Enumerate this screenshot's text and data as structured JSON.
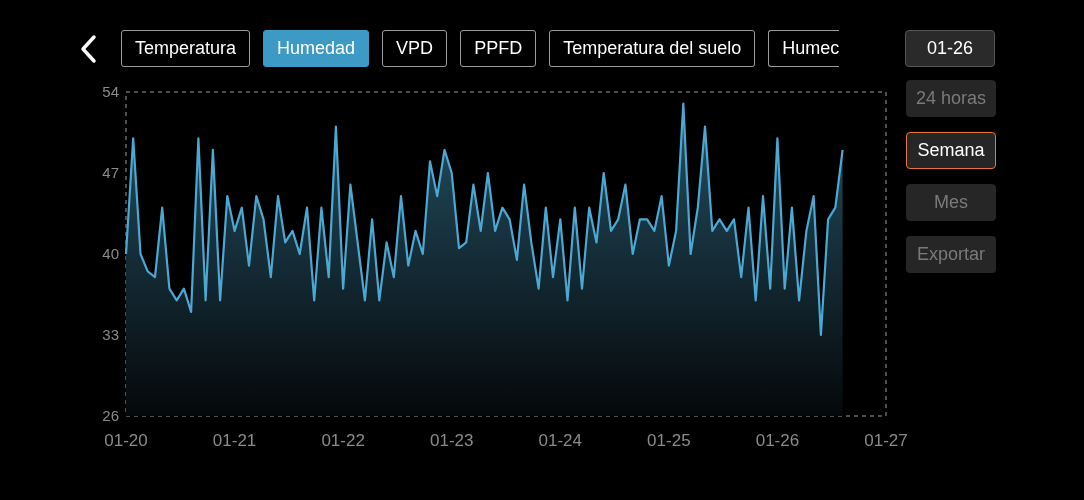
{
  "tabs": [
    {
      "label": "Temperatura",
      "selected": false
    },
    {
      "label": "Humedad",
      "selected": true
    },
    {
      "label": "VPD",
      "selected": false
    },
    {
      "label": "PPFD",
      "selected": false
    },
    {
      "label": "Temperatura del suelo",
      "selected": false
    },
    {
      "label": "Humec",
      "selected": false
    }
  ],
  "date_button": "01-26",
  "range_buttons": [
    {
      "label": "24 horas",
      "selected": false
    },
    {
      "label": "Semana",
      "selected": true
    },
    {
      "label": "Mes",
      "selected": false
    }
  ],
  "export_button": "Exportar",
  "chart_data": {
    "type": "area",
    "ylim": [
      26,
      54
    ],
    "yticks": [
      26,
      33,
      40,
      47,
      54
    ],
    "categories": [
      "01-20",
      null,
      null,
      null,
      null,
      null,
      null,
      null,
      null,
      null,
      null,
      null,
      null,
      null,
      null,
      "01-21",
      null,
      null,
      null,
      null,
      null,
      null,
      null,
      null,
      null,
      null,
      null,
      null,
      null,
      null,
      "01-22",
      null,
      null,
      null,
      null,
      null,
      null,
      null,
      null,
      null,
      null,
      null,
      null,
      null,
      null,
      "01-23",
      null,
      null,
      null,
      null,
      null,
      null,
      null,
      null,
      null,
      null,
      null,
      null,
      null,
      null,
      "01-24",
      null,
      null,
      null,
      null,
      null,
      null,
      null,
      null,
      null,
      null,
      null,
      null,
      null,
      null,
      "01-25",
      null,
      null,
      null,
      null,
      null,
      null,
      null,
      null,
      null,
      null,
      null,
      null,
      null,
      null,
      "01-26",
      null,
      null,
      null,
      null,
      null,
      null,
      null,
      null,
      null,
      null,
      null,
      null,
      null,
      null,
      "01-27"
    ],
    "series": [
      {
        "color": "#4aa8d3",
        "values": [
          40,
          50,
          40,
          38.5,
          38,
          44,
          37,
          36,
          37,
          35,
          50,
          36,
          49,
          36,
          45,
          42,
          44,
          39,
          45,
          43,
          38,
          45,
          41,
          42,
          40,
          44,
          36,
          44,
          38,
          51,
          37,
          46,
          41,
          36,
          43,
          36,
          41,
          38,
          45,
          39,
          42,
          40,
          48,
          45,
          49,
          47,
          40.5,
          41,
          46,
          42,
          47,
          42,
          44,
          43,
          39.5,
          46,
          41,
          37,
          44,
          38,
          43,
          36,
          44,
          37,
          44,
          41,
          47,
          42,
          43,
          46,
          40,
          43,
          43,
          42,
          45,
          39,
          42,
          53,
          40,
          44,
          51,
          42,
          43,
          42,
          43,
          38,
          44,
          36,
          45,
          37,
          50,
          37,
          44,
          36,
          42,
          45,
          33,
          43,
          44,
          49,
          null,
          null,
          null,
          null,
          null,
          null
        ]
      }
    ]
  }
}
